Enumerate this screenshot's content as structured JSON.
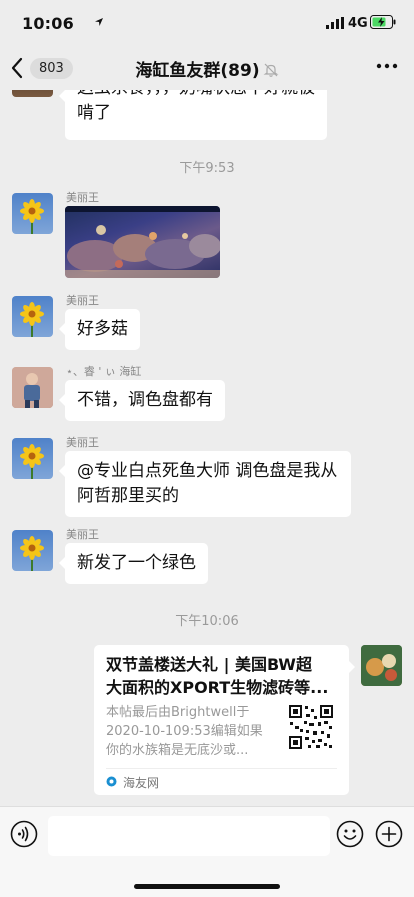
{
  "status_bar": {
    "time": "10:06",
    "network": "4G"
  },
  "nav": {
    "unread_count": "803",
    "title": "海缸鱼友群(89)"
  },
  "messages": {
    "partial_text_line1": "这虫杀食，，，奶嘴状态不好就被",
    "partial_text_line2": "啃了",
    "time1": "下午9:53",
    "m1_sender": "美丽王",
    "m2_sender": "美丽王",
    "m2_text": "好多菇",
    "m3_sender": "⋆、睿 ' ぃ 海缸",
    "m3_text": "不错，调色盘都有",
    "m4_sender": "美丽王",
    "m4_text_line1": "@专业白点死鱼大师 调色盘是我从",
    "m4_text_line2": "阿哲那里买的",
    "m5_sender": "美丽王",
    "m5_text": "新发了一个绿色",
    "time2": "下午10:06"
  },
  "link_card": {
    "title_line1": "双节盖楼送大礼 | 美国BW超",
    "title_line2": "大面积的XPORT生物滤砖等...",
    "desc_line1": "本帖最后由Brightwell于",
    "desc_line2": "2020-10-109:53编辑如果",
    "desc_line3": "你的水族箱是无底沙或...",
    "source": "海友网"
  },
  "icons": [
    "location-arrow-icon",
    "signal-icon",
    "battery-charging-icon",
    "back-chevron-icon",
    "mute-bell-icon",
    "more-dots-icon",
    "voice-icon",
    "emoji-icon",
    "plus-icon",
    "qr-code-icon"
  ],
  "colors": {
    "background": "#ededed",
    "bubble": "#ffffff",
    "battery_charge": "#4cd964"
  }
}
